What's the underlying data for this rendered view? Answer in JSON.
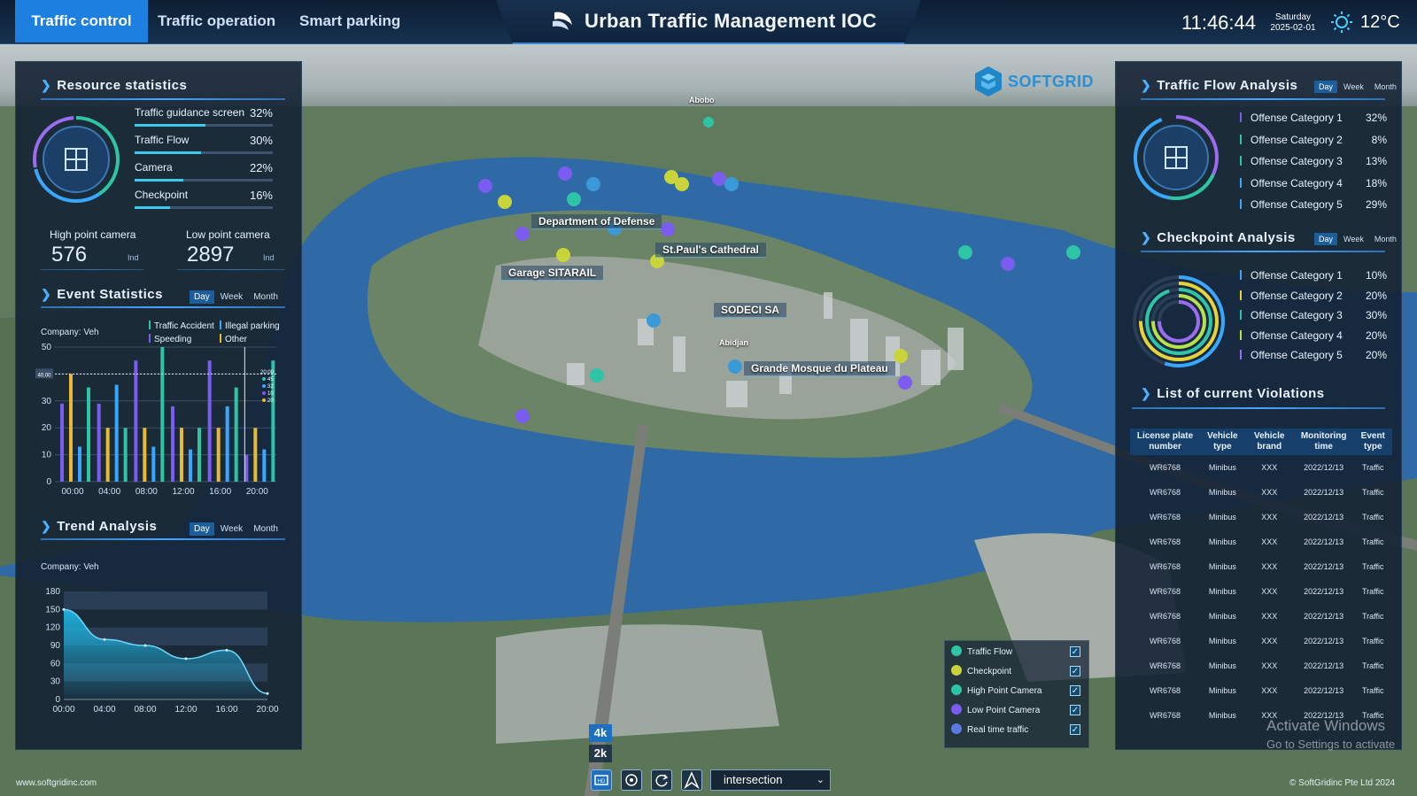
{
  "nav": {
    "tabs": [
      "Traffic control",
      "Traffic operation",
      "Smart parking"
    ],
    "active_index": 0
  },
  "header": {
    "title": "Urban Traffic Management IOC",
    "time": "11:46:44",
    "weekday": "Saturday",
    "date": "2025-02-01",
    "temperature": "12°C",
    "weather_icon": "sun-icon"
  },
  "brand": {
    "logo_text": "SOFTGRID"
  },
  "resource_statistics": {
    "title": "Resource statistics",
    "items": [
      {
        "label": "Traffic guidance screen",
        "pct": "32%",
        "value": 32
      },
      {
        "label": "Traffic Flow",
        "pct": "30%",
        "value": 30
      },
      {
        "label": "Camera",
        "pct": "22%",
        "value": 22
      },
      {
        "label": "Checkpoint",
        "pct": "16%",
        "value": 16
      }
    ],
    "high_point_camera": {
      "label": "High point camera",
      "value": "576",
      "unit": "Ind"
    },
    "low_point_camera": {
      "label": "Low point camera",
      "value": "2897",
      "unit": "Ind"
    }
  },
  "event_statistics": {
    "title": "Event Statistics",
    "periods": [
      "Day",
      "Week",
      "Month"
    ],
    "active_period": 0,
    "company_label": "Company:  Veh",
    "legend": [
      {
        "name": "Traffic Accident",
        "color": "#2ec4a6"
      },
      {
        "name": "Illegal parking",
        "color": "#3aa7ff"
      },
      {
        "name": "Speeding",
        "color": "#7a5cf0"
      },
      {
        "name": "Other",
        "color": "#e8b838"
      }
    ],
    "tooltip_badge": "40.00",
    "tooltip_mini": {
      "time": "20:00",
      "values": [
        "45",
        "32",
        "10",
        "20"
      ]
    }
  },
  "chart_data": [
    {
      "type": "bar",
      "categories": [
        "00:00",
        "04:00",
        "08:00",
        "12:00",
        "16:00",
        "20:00"
      ],
      "series": [
        {
          "name": "Traffic Accident",
          "values": [
            35,
            20,
            50,
            20,
            35,
            45
          ]
        },
        {
          "name": "Illegal parking",
          "values": [
            13,
            36,
            13,
            12,
            28,
            12
          ]
        },
        {
          "name": "Speeding",
          "values": [
            29,
            29,
            45,
            28,
            45,
            10
          ]
        },
        {
          "name": "Other",
          "values": [
            40,
            20,
            20,
            20,
            20,
            20
          ]
        }
      ],
      "ylim": [
        0,
        50
      ],
      "yticks": [
        0,
        10,
        20,
        30,
        40,
        50
      ],
      "grid": true
    },
    {
      "type": "area",
      "x": [
        "00:00",
        "04:00",
        "08:00",
        "12:00",
        "16:00",
        "20:00"
      ],
      "series": [
        {
          "values": [
            150,
            100,
            90,
            68,
            82,
            10
          ]
        }
      ],
      "ylim": [
        0,
        180
      ],
      "yticks": [
        0,
        30,
        60,
        90,
        120,
        150,
        180
      ],
      "grid": true
    }
  ],
  "trend_analysis": {
    "title": "Trend Analysis",
    "periods": [
      "Day",
      "Week",
      "Month"
    ],
    "active_period": 0,
    "company_label": "Company:  Veh"
  },
  "traffic_flow_analysis": {
    "title": "Traffic Flow Analysis",
    "periods": [
      "Day",
      "Week",
      "Month"
    ],
    "active_period": 0,
    "categories": [
      {
        "label": "Offense Category 1",
        "pct": "32%",
        "color": "#7a5cf0"
      },
      {
        "label": "Offense Category 2",
        "pct": "8%",
        "color": "#2ec4a6"
      },
      {
        "label": "Offense Category 3",
        "pct": "13%",
        "color": "#2ec4a6"
      },
      {
        "label": "Offense Category 4",
        "pct": "18%",
        "color": "#3aa7ff"
      },
      {
        "label": "Offense Category 5",
        "pct": "29%",
        "color": "#3aa7ff"
      }
    ]
  },
  "checkpoint_analysis": {
    "title": "Checkpoint Analysis",
    "periods": [
      "Day",
      "Week",
      "Month"
    ],
    "active_period": 0,
    "categories": [
      {
        "label": "Offense Category 1",
        "pct": "10%",
        "value": 10,
        "color": "#3aa7ff"
      },
      {
        "label": "Offense Category 2",
        "pct": "20%",
        "value": 20,
        "color": "#e8d23a"
      },
      {
        "label": "Offense Category 3",
        "pct": "30%",
        "value": 30,
        "color": "#2ec4a6"
      },
      {
        "label": "Offense Category 4",
        "pct": "20%",
        "value": 20,
        "color": "#b8e04a"
      },
      {
        "label": "Offense Category 5",
        "pct": "20%",
        "value": 20,
        "color": "#9b6cf0"
      }
    ]
  },
  "violations": {
    "title": "List of current Violations",
    "columns": [
      "License plate number",
      "Vehicle type",
      "Vehicle brand",
      "Monitoring time",
      "Event type"
    ],
    "rows": [
      [
        "WR6768",
        "Minibus",
        "XXX",
        "2022/12/13",
        "Traffic"
      ],
      [
        "WR6768",
        "Minibus",
        "XXX",
        "2022/12/13",
        "Traffic"
      ],
      [
        "WR6768",
        "Minibus",
        "XXX",
        "2022/12/13",
        "Traffic"
      ],
      [
        "WR6768",
        "Minibus",
        "XXX",
        "2022/12/13",
        "Traffic"
      ],
      [
        "WR6768",
        "Minibus",
        "XXX",
        "2022/12/13",
        "Traffic"
      ],
      [
        "WR6768",
        "Minibus",
        "XXX",
        "2022/12/13",
        "Traffic"
      ],
      [
        "WR6768",
        "Minibus",
        "XXX",
        "2022/12/13",
        "Traffic"
      ],
      [
        "WR6768",
        "Minibus",
        "XXX",
        "2022/12/13",
        "Traffic"
      ],
      [
        "WR6768",
        "Minibus",
        "XXX",
        "2022/12/13",
        "Traffic"
      ],
      [
        "WR6768",
        "Minibus",
        "XXX",
        "2022/12/13",
        "Traffic"
      ],
      [
        "WR6768",
        "Minibus",
        "XXX",
        "2022/12/13",
        "Traffic"
      ]
    ]
  },
  "map": {
    "labels": {
      "abobo": "Abobo",
      "department": "Department of Defense",
      "cathedral": "St.Paul's Cathedral",
      "garage": "Garage SITARAIL",
      "sodeci": "SODECI SA",
      "abidjan": "Abidjan",
      "mosque": "Grande Mosque du Plateau"
    },
    "layers": [
      {
        "label": "Traffic Flow",
        "icon": "traffic-flow-icon",
        "color": "#2ec4a6",
        "checked": true
      },
      {
        "label": "Checkpoint",
        "icon": "checkpoint-icon",
        "color": "#c8d43a",
        "checked": true
      },
      {
        "label": "High Point Camera",
        "icon": "high-camera-icon",
        "color": "#2ec4a6",
        "checked": true
      },
      {
        "label": "Low Point Camera",
        "icon": "low-camera-icon",
        "color": "#7a5cf0",
        "checked": true
      },
      {
        "label": "Real time traffic",
        "icon": "realtime-traffic-icon",
        "color": "#5a7ae0",
        "checked": true
      }
    ],
    "check_mark": "✓",
    "resolutions": [
      "4k",
      "2k"
    ],
    "view_select": "intersection"
  },
  "footer": {
    "website": "www.softgridinc.com",
    "copyright": "© SoftGridinc Pte Ltd 2024"
  },
  "watermark": {
    "line1": "Activate Windows",
    "line2": "Go to Settings to activate"
  }
}
